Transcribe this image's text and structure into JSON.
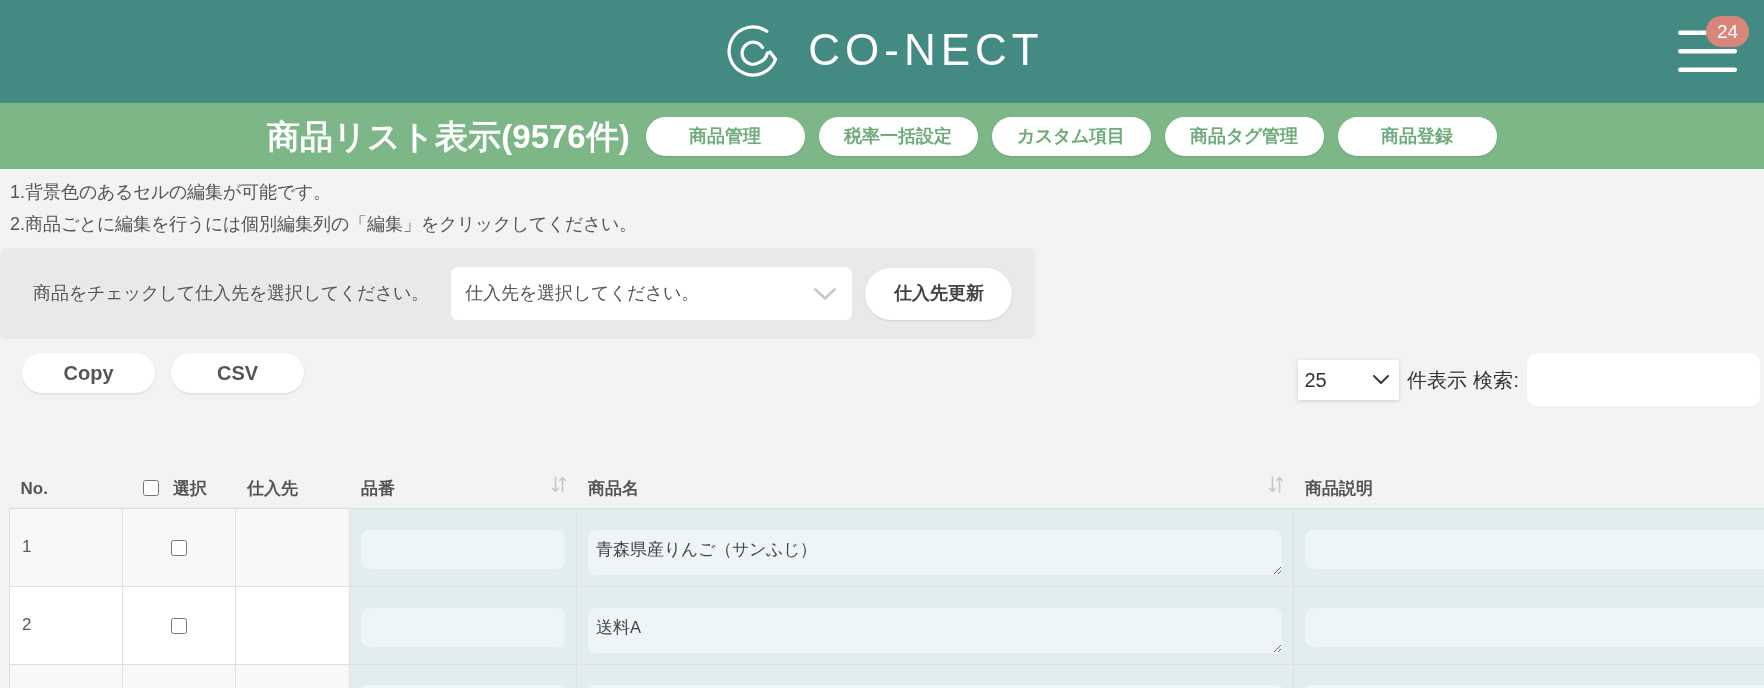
{
  "header": {
    "logo": "CO-NECT",
    "badge": "24"
  },
  "title_bar": {
    "title": "商品リスト表示(9576件)",
    "buttons": [
      "商品管理",
      "税率一括設定",
      "カスタム項目",
      "商品タグ管理",
      "商品登録"
    ]
  },
  "notes": [
    "1.背景色のあるセルの編集が可能です。",
    "2.商品ごとに編集を行うには個別編集列の「編集」をクリックしてください。"
  ],
  "supplier_panel": {
    "label": "商品をチェックして仕入先を選択してください。",
    "select": "仕入先を選択してください。",
    "button": "仕入先更新"
  },
  "export_buttons": [
    "Copy",
    "CSV"
  ],
  "page_length": {
    "value": "25",
    "label": "件表示"
  },
  "search": {
    "label": "検索:"
  },
  "table": {
    "select_all_checked": false,
    "columns": [
      {
        "label": "No.",
        "kind": "number",
        "sortable": false
      },
      {
        "label": "選択",
        "kind": "check",
        "sortable": false
      },
      {
        "label": "仕入先",
        "kind": "text",
        "sortable": false
      },
      {
        "label": "品番",
        "kind": "field",
        "sortable": true
      },
      {
        "label": "商品名",
        "kind": "memo",
        "sortable": true
      },
      {
        "label": "商品説明",
        "kind": "field",
        "sortable": false
      }
    ],
    "rows": [
      {
        "no": "1",
        "checked": false,
        "name": "青森県産りんご（サンふじ）"
      },
      {
        "no": "2",
        "checked": false,
        "name": "送料A"
      }
    ]
  }
}
